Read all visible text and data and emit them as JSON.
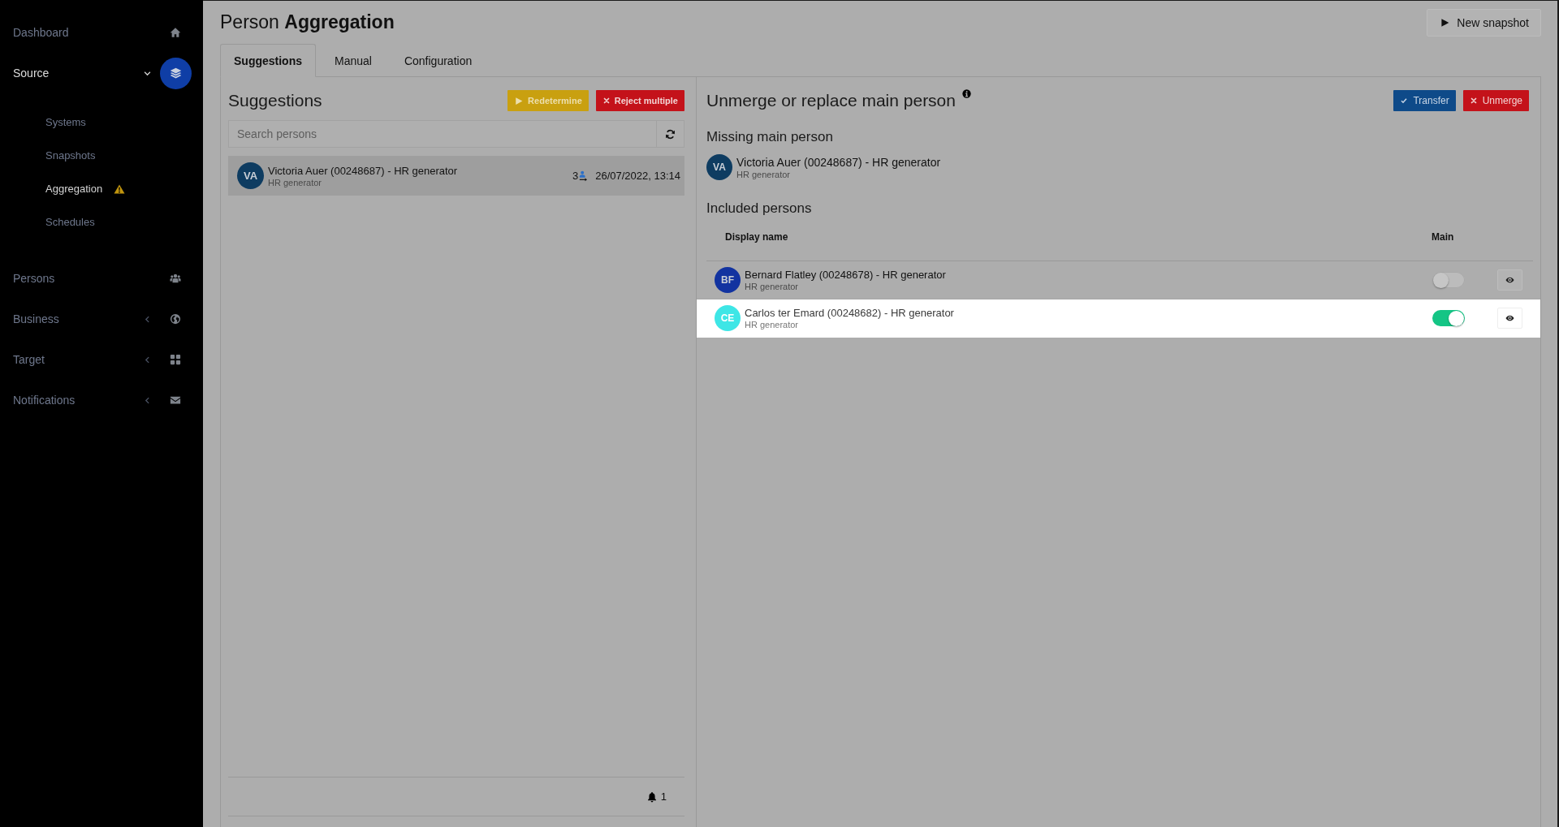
{
  "sidebar": {
    "items": [
      {
        "label": "Dashboard",
        "selected": false
      },
      {
        "label": "Source",
        "selected": true,
        "expanded": true,
        "children": [
          {
            "label": "Systems",
            "selected": false
          },
          {
            "label": "Snapshots",
            "selected": false
          },
          {
            "label": "Aggregation",
            "selected": true,
            "warning": true
          },
          {
            "label": "Schedules",
            "selected": false
          }
        ]
      },
      {
        "label": "Persons",
        "selected": false
      },
      {
        "label": "Business",
        "selected": false,
        "expanded": false
      },
      {
        "label": "Target",
        "selected": false,
        "expanded": false
      },
      {
        "label": "Notifications",
        "selected": false,
        "expanded": false
      }
    ]
  },
  "header": {
    "title": "Person **Aggregation**",
    "button": "New snapshot"
  },
  "tabs": [
    {
      "label": "Suggestions",
      "selected": true
    },
    {
      "label": "Manual",
      "selected": false
    },
    {
      "label": "Configuration",
      "selected": false
    }
  ],
  "suggestions": {
    "title": "Suggestions",
    "buttons": [
      {
        "label": "Redetermine",
        "kind": "run"
      },
      {
        "label": "Reject multiple",
        "kind": "reject"
      }
    ],
    "search": {
      "placeholder": "Search persons"
    },
    "items": [
      {
        "initials": "VA",
        "color": "#0e3c61",
        "name": "Victoria Auer (00248687) - HR generator",
        "source": "HR generator",
        "count": "3",
        "date": "26/07/2022, 13:14",
        "selected": true
      }
    ],
    "notifications": "1"
  },
  "detail": {
    "title": "Unmerge or replace main person",
    "buttons": [
      {
        "label": "Transfer",
        "kind": "confirm"
      },
      {
        "label": "Unmerge",
        "kind": "reject"
      }
    ],
    "missing": {
      "title": "Missing main person",
      "person": {
        "initials": "VA",
        "color": "#0e3c61",
        "name": "Victoria Auer (00248687) - HR generator",
        "source": "HR generator"
      }
    },
    "included": {
      "title": "Included persons",
      "columns": [
        "Display name",
        "Main"
      ],
      "rows": [
        {
          "initials": "BF",
          "color": "#1233a0",
          "name": "Bernard Flatley (00248678) - HR generator",
          "source": "HR generator",
          "main": false,
          "highlighted": false
        },
        {
          "initials": "CE",
          "color": "#3ee6e6",
          "name": "Carlos ter Emard (00248682) - HR generator",
          "source": "HR generator",
          "main": true,
          "highlighted": true
        }
      ]
    }
  }
}
